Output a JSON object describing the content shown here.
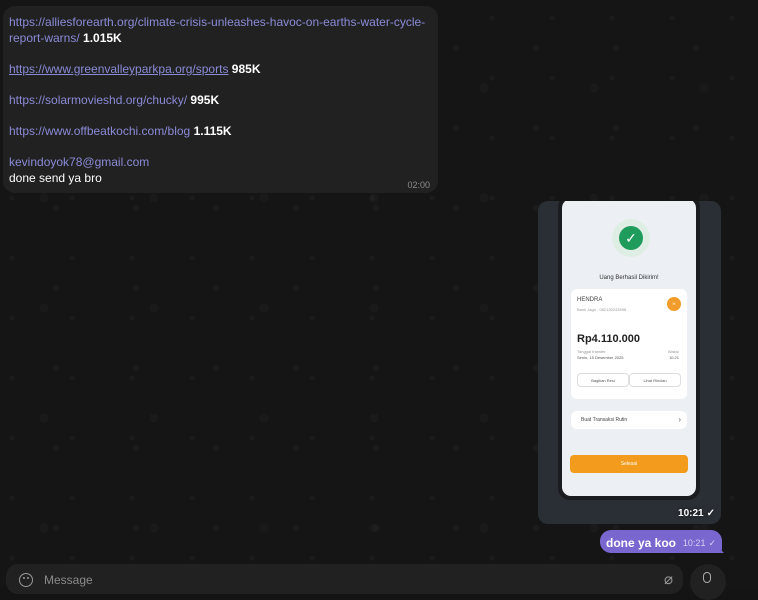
{
  "incoming_message": {
    "lines": [
      {
        "link": "https://alliesforearth.org/climate-crisis-unleashes-havoc-on-earths-water-cycle-report-warns/",
        "size": "1.015K"
      },
      {
        "link": "https://www.greenvalleyparkpa.org/sports",
        "size": "985K"
      },
      {
        "link": "https://solarmovieshd.org/chucky/",
        "size": "995K"
      },
      {
        "link": "https://www.offbeatkochi.com/blog",
        "size": "1.115K"
      }
    ],
    "email": "kevindoyok78@gmail.com",
    "text": "done send ya bro",
    "time": "02:00"
  },
  "outgoing_image": {
    "time": "10:21",
    "screenshot": {
      "title": "Uang Berhasil Dikirim!",
      "recipient": "HENDRA",
      "bank": "Bank Jago - 082130243998",
      "avatar": "H",
      "amount": "Rp4.110.000",
      "date_label": "Tanggal transfer",
      "date": "Senin, 15 Desember 2025",
      "time_label": "Waktu",
      "time": "10.21",
      "share_label": "Bagikan Resi",
      "detail_label": "Lihat Rincian",
      "routine_label": "Buat Transaksi Rutin",
      "done_label": "Selesai"
    }
  },
  "outgoing_message": {
    "text": "done ya koo",
    "time": "10:21"
  },
  "composer": {
    "placeholder": "Message"
  },
  "icons": {
    "emoji": "smiley-icon",
    "attach": "paperclip-icon",
    "mic": "microphone-icon",
    "check": "checkmark-icon"
  }
}
